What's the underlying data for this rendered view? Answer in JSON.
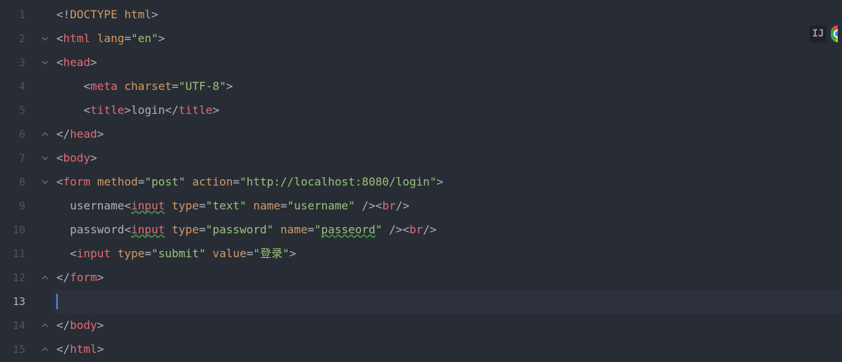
{
  "lines": [
    {
      "num": "1",
      "indent": "",
      "fold": "",
      "tokens": [
        [
          "tag-bracket",
          "<!"
        ],
        [
          "doctype",
          "DOCTYPE html"
        ],
        [
          "tag-bracket",
          ">"
        ]
      ]
    },
    {
      "num": "2",
      "indent": "",
      "fold": "open",
      "tokens": [
        [
          "tag-bracket",
          "<"
        ],
        [
          "tag-name",
          "html"
        ],
        [
          "text",
          " "
        ],
        [
          "attr-name",
          "lang"
        ],
        [
          "tag-bracket",
          "="
        ],
        [
          "attr-val",
          "\"en\""
        ],
        [
          "tag-bracket",
          ">"
        ]
      ]
    },
    {
      "num": "3",
      "indent": "",
      "fold": "open",
      "tokens": [
        [
          "tag-bracket",
          "<"
        ],
        [
          "tag-name",
          "head"
        ],
        [
          "tag-bracket",
          ">"
        ]
      ]
    },
    {
      "num": "4",
      "indent": "    ",
      "fold": "",
      "tokens": [
        [
          "tag-bracket",
          "<"
        ],
        [
          "tag-name",
          "meta"
        ],
        [
          "text",
          " "
        ],
        [
          "attr-name",
          "charset"
        ],
        [
          "tag-bracket",
          "="
        ],
        [
          "attr-val",
          "\"UTF-8\""
        ],
        [
          "tag-bracket",
          ">"
        ]
      ]
    },
    {
      "num": "5",
      "indent": "    ",
      "fold": "",
      "tokens": [
        [
          "tag-bracket",
          "<"
        ],
        [
          "tag-name",
          "title"
        ],
        [
          "tag-bracket",
          ">"
        ],
        [
          "text",
          "login"
        ],
        [
          "tag-bracket",
          "</"
        ],
        [
          "tag-name",
          "title"
        ],
        [
          "tag-bracket",
          ">"
        ]
      ]
    },
    {
      "num": "6",
      "indent": "",
      "fold": "close",
      "tokens": [
        [
          "tag-bracket",
          "</"
        ],
        [
          "tag-name",
          "head"
        ],
        [
          "tag-bracket",
          ">"
        ]
      ]
    },
    {
      "num": "7",
      "indent": "",
      "fold": "open",
      "tokens": [
        [
          "tag-bracket",
          "<"
        ],
        [
          "tag-name",
          "body"
        ],
        [
          "tag-bracket",
          ">"
        ]
      ]
    },
    {
      "num": "8",
      "indent": "",
      "fold": "open",
      "tokens": [
        [
          "tag-bracket",
          "<"
        ],
        [
          "tag-name",
          "form"
        ],
        [
          "text",
          " "
        ],
        [
          "attr-name",
          "method"
        ],
        [
          "tag-bracket",
          "="
        ],
        [
          "attr-val",
          "\"post\""
        ],
        [
          "text",
          " "
        ],
        [
          "attr-name",
          "action"
        ],
        [
          "tag-bracket",
          "="
        ],
        [
          "attr-val",
          "\"http://localhost:8080/login\""
        ],
        [
          "tag-bracket",
          ">"
        ]
      ]
    },
    {
      "num": "9",
      "indent": "  ",
      "fold": "",
      "tokens": [
        [
          "text",
          "username"
        ],
        [
          "tag-bracket",
          "<"
        ],
        [
          "tag-name underline-green",
          "input"
        ],
        [
          "text",
          " "
        ],
        [
          "attr-name",
          "type"
        ],
        [
          "tag-bracket",
          "="
        ],
        [
          "attr-val",
          "\"text\""
        ],
        [
          "text",
          " "
        ],
        [
          "attr-name",
          "name"
        ],
        [
          "tag-bracket",
          "="
        ],
        [
          "attr-val",
          "\"username\""
        ],
        [
          "text",
          " "
        ],
        [
          "tag-bracket",
          "/><"
        ],
        [
          "tag-name",
          "br"
        ],
        [
          "tag-bracket",
          "/>"
        ]
      ]
    },
    {
      "num": "10",
      "indent": "  ",
      "fold": "",
      "tokens": [
        [
          "text",
          "password"
        ],
        [
          "tag-bracket",
          "<"
        ],
        [
          "tag-name underline-green",
          "input"
        ],
        [
          "text",
          " "
        ],
        [
          "attr-name",
          "type"
        ],
        [
          "tag-bracket",
          "="
        ],
        [
          "attr-val",
          "\"password\""
        ],
        [
          "text",
          " "
        ],
        [
          "attr-name",
          "name"
        ],
        [
          "tag-bracket",
          "="
        ],
        [
          "attr-val",
          "\""
        ],
        [
          "attr-val underline-green",
          "passeord"
        ],
        [
          "attr-val",
          "\""
        ],
        [
          "text",
          " "
        ],
        [
          "tag-bracket",
          "/><"
        ],
        [
          "tag-name",
          "br"
        ],
        [
          "tag-bracket",
          "/>"
        ]
      ]
    },
    {
      "num": "11",
      "indent": "  ",
      "fold": "",
      "tokens": [
        [
          "tag-bracket",
          "<"
        ],
        [
          "tag-name",
          "input"
        ],
        [
          "text",
          " "
        ],
        [
          "attr-name",
          "type"
        ],
        [
          "tag-bracket",
          "="
        ],
        [
          "attr-val",
          "\"submit\""
        ],
        [
          "text",
          " "
        ],
        [
          "attr-name",
          "value"
        ],
        [
          "tag-bracket",
          "="
        ],
        [
          "attr-val",
          "\"登录\""
        ],
        [
          "tag-bracket",
          ">"
        ]
      ]
    },
    {
      "num": "12",
      "indent": "",
      "fold": "close",
      "tokens": [
        [
          "tag-bracket",
          "</"
        ],
        [
          "tag-name",
          "form"
        ],
        [
          "tag-bracket",
          ">"
        ]
      ]
    },
    {
      "num": "13",
      "indent": "",
      "fold": "",
      "active": true,
      "tokens": []
    },
    {
      "num": "14",
      "indent": "",
      "fold": "close",
      "tokens": [
        [
          "tag-bracket",
          "</"
        ],
        [
          "tag-name",
          "body"
        ],
        [
          "tag-bracket",
          ">"
        ]
      ]
    },
    {
      "num": "15",
      "indent": "",
      "fold": "close",
      "tokens": [
        [
          "tag-bracket",
          "</"
        ],
        [
          "tag-name",
          "html"
        ],
        [
          "tag-bracket",
          ">"
        ]
      ]
    }
  ],
  "ij_label": "IJ"
}
